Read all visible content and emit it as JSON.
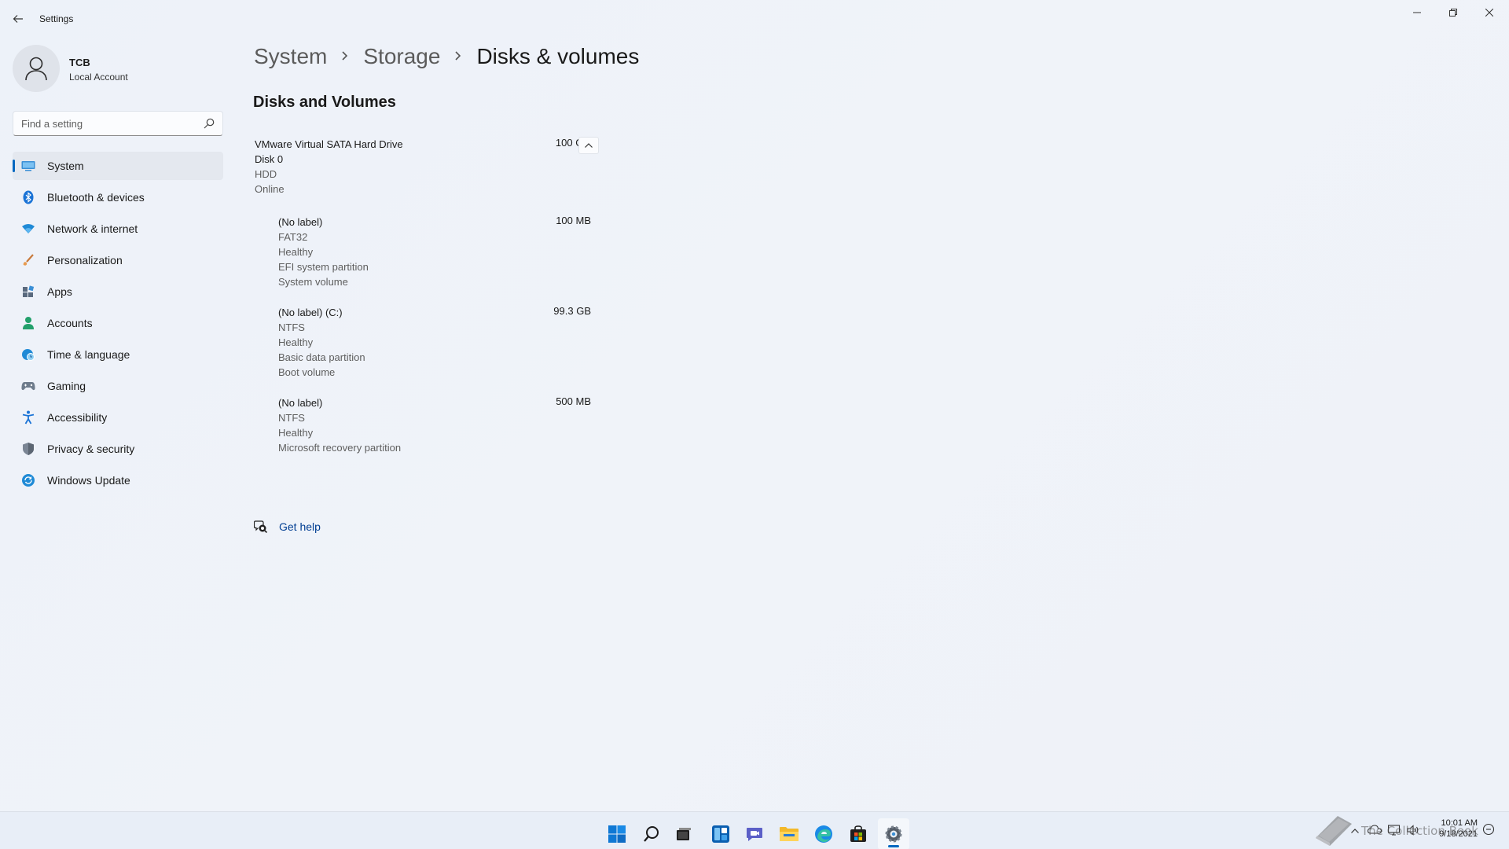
{
  "window": {
    "app_title": "Settings",
    "controls": [
      "minimize",
      "restore",
      "close"
    ]
  },
  "user": {
    "name": "TCB",
    "account_type": "Local Account"
  },
  "search": {
    "placeholder": "Find a setting",
    "value": ""
  },
  "sidebar": {
    "items": [
      {
        "label": "System",
        "icon": "system-icon",
        "active": true
      },
      {
        "label": "Bluetooth & devices",
        "icon": "bluetooth-icon",
        "active": false
      },
      {
        "label": "Network & internet",
        "icon": "wifi-icon",
        "active": false
      },
      {
        "label": "Personalization",
        "icon": "brush-icon",
        "active": false
      },
      {
        "label": "Apps",
        "icon": "apps-icon",
        "active": false
      },
      {
        "label": "Accounts",
        "icon": "accounts-icon",
        "active": false
      },
      {
        "label": "Time & language",
        "icon": "globe-clock-icon",
        "active": false
      },
      {
        "label": "Gaming",
        "icon": "gamepad-icon",
        "active": false
      },
      {
        "label": "Accessibility",
        "icon": "accessibility-icon",
        "active": false
      },
      {
        "label": "Privacy & security",
        "icon": "shield-icon",
        "active": false
      },
      {
        "label": "Windows Update",
        "icon": "update-icon",
        "active": false
      }
    ]
  },
  "breadcrumb": {
    "items": [
      "System",
      "Storage",
      "Disks & volumes"
    ]
  },
  "main": {
    "section_title": "Disks and Volumes",
    "disk": {
      "name": "VMware Virtual SATA Hard Drive",
      "size": "100 GB",
      "details": [
        "Disk 0",
        "HDD",
        "Online"
      ],
      "expanded": true
    },
    "volumes": [
      {
        "label": "(No label)",
        "size": "100 MB",
        "details": [
          "FAT32",
          "Healthy",
          "EFI system partition",
          "System volume"
        ]
      },
      {
        "label": "(No label) (C:)",
        "size": "99.3 GB",
        "details": [
          "NTFS",
          "Healthy",
          "Basic data partition",
          "Boot volume"
        ]
      },
      {
        "label": "(No label)",
        "size": "500 MB",
        "details": [
          "NTFS",
          "Healthy",
          "Microsoft recovery partition"
        ]
      }
    ],
    "get_help": "Get help"
  },
  "taskbar": {
    "apps": [
      "start-icon",
      "search-icon",
      "task-view-icon",
      "widgets-icon",
      "chat-icon",
      "file-explorer-icon",
      "edge-icon",
      "store-icon",
      "settings-icon"
    ],
    "active_app": "settings-icon",
    "time": "10:01 AM",
    "date": "9/18/2021"
  },
  "watermark": {
    "text": "The Collection Book"
  },
  "colors": {
    "accent": "#0067c0",
    "link": "#003e92",
    "background": "#eef2f8"
  }
}
